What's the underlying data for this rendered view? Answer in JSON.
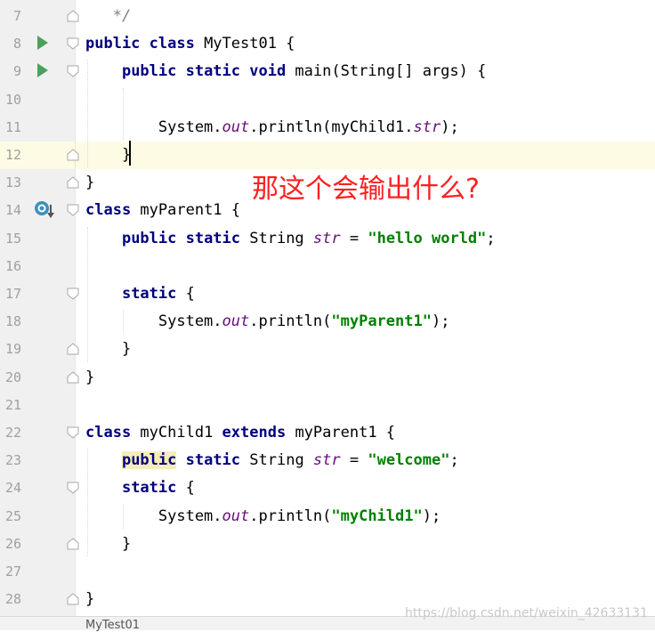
{
  "editor": {
    "lines": [
      {
        "n": "7",
        "tokens": [
          {
            "t": "   "
          },
          {
            "t": "*/",
            "c": "cmt"
          }
        ]
      },
      {
        "n": "8",
        "tokens": [
          {
            "t": "public class",
            "c": "kw"
          },
          {
            "t": " MyTest01 {"
          }
        ]
      },
      {
        "n": "9",
        "tokens": [
          {
            "t": "    "
          },
          {
            "t": "public static void",
            "c": "kw"
          },
          {
            "t": " main(String[] args) {"
          }
        ]
      },
      {
        "n": "10",
        "tokens": []
      },
      {
        "n": "11",
        "tokens": [
          {
            "t": "        System."
          },
          {
            "t": "out",
            "c": "fld"
          },
          {
            "t": ".println(myChild1."
          },
          {
            "t": "str",
            "c": "fld"
          },
          {
            "t": ");"
          }
        ]
      },
      {
        "n": "12",
        "tokens": [
          {
            "t": "    }"
          }
        ]
      },
      {
        "n": "13",
        "tokens": [
          {
            "t": "}"
          }
        ]
      },
      {
        "n": "14",
        "tokens": [
          {
            "t": "class",
            "c": "kw"
          },
          {
            "t": " myParent1 {"
          }
        ]
      },
      {
        "n": "15",
        "tokens": [
          {
            "t": "    "
          },
          {
            "t": "public static",
            "c": "kw"
          },
          {
            "t": " String "
          },
          {
            "t": "str",
            "c": "fld"
          },
          {
            "t": " = "
          },
          {
            "t": "\"hello world\"",
            "c": "str"
          },
          {
            "t": ";"
          }
        ]
      },
      {
        "n": "16",
        "tokens": []
      },
      {
        "n": "17",
        "tokens": [
          {
            "t": "    "
          },
          {
            "t": "static",
            "c": "kw"
          },
          {
            "t": " {"
          }
        ]
      },
      {
        "n": "18",
        "tokens": [
          {
            "t": "        System."
          },
          {
            "t": "out",
            "c": "fld"
          },
          {
            "t": ".println("
          },
          {
            "t": "\"myParent1\"",
            "c": "str"
          },
          {
            "t": ");"
          }
        ]
      },
      {
        "n": "19",
        "tokens": [
          {
            "t": "    }"
          }
        ]
      },
      {
        "n": "20",
        "tokens": [
          {
            "t": "}"
          }
        ]
      },
      {
        "n": "21",
        "tokens": []
      },
      {
        "n": "22",
        "tokens": [
          {
            "t": "class",
            "c": "kw"
          },
          {
            "t": " myChild1 "
          },
          {
            "t": "extends",
            "c": "kw"
          },
          {
            "t": " myParent1 {"
          }
        ]
      },
      {
        "n": "23",
        "tokens": [
          {
            "t": "    "
          },
          {
            "t": "public",
            "c": "kw hl"
          },
          {
            "t": " static",
            "c": "kw"
          },
          {
            "t": " String "
          },
          {
            "t": "str",
            "c": "fld"
          },
          {
            "t": " = "
          },
          {
            "t": "\"welcome\"",
            "c": "str"
          },
          {
            "t": ";"
          }
        ]
      },
      {
        "n": "24",
        "tokens": [
          {
            "t": "    "
          },
          {
            "t": "static",
            "c": "kw"
          },
          {
            "t": " {"
          }
        ]
      },
      {
        "n": "25",
        "tokens": [
          {
            "t": "        System."
          },
          {
            "t": "out",
            "c": "fld"
          },
          {
            "t": ".println("
          },
          {
            "t": "\"myChild1\"",
            "c": "str"
          },
          {
            "t": ");"
          }
        ]
      },
      {
        "n": "26",
        "tokens": [
          {
            "t": "    }"
          }
        ]
      },
      {
        "n": "27",
        "tokens": []
      },
      {
        "n": "28",
        "tokens": [
          {
            "t": "}"
          }
        ]
      }
    ],
    "current_line": "12",
    "run_gutter_lines": [
      "8",
      "9"
    ],
    "override_gutter_lines": [
      "14"
    ],
    "fold_markers": {
      "open": [
        "8",
        "9",
        "14",
        "17",
        "22",
        "24"
      ],
      "close": [
        "7",
        "12",
        "13",
        "19",
        "20",
        "26",
        "28"
      ]
    }
  },
  "annotation": {
    "text": "那这个会输出什么?"
  },
  "bottom_tab": {
    "label": "MyTest01"
  },
  "watermark": {
    "text": "https://blog.csdn.net/weixin_42633131"
  },
  "colors": {
    "keyword": "#000080",
    "field": "#660e7a",
    "string": "#008000",
    "annotation": "#ff2020",
    "run_icon": "#4ca05a"
  },
  "icons": {
    "run": "run-triangle-icon",
    "override": "override-method-icon",
    "fold": "fold-marker-icon"
  }
}
